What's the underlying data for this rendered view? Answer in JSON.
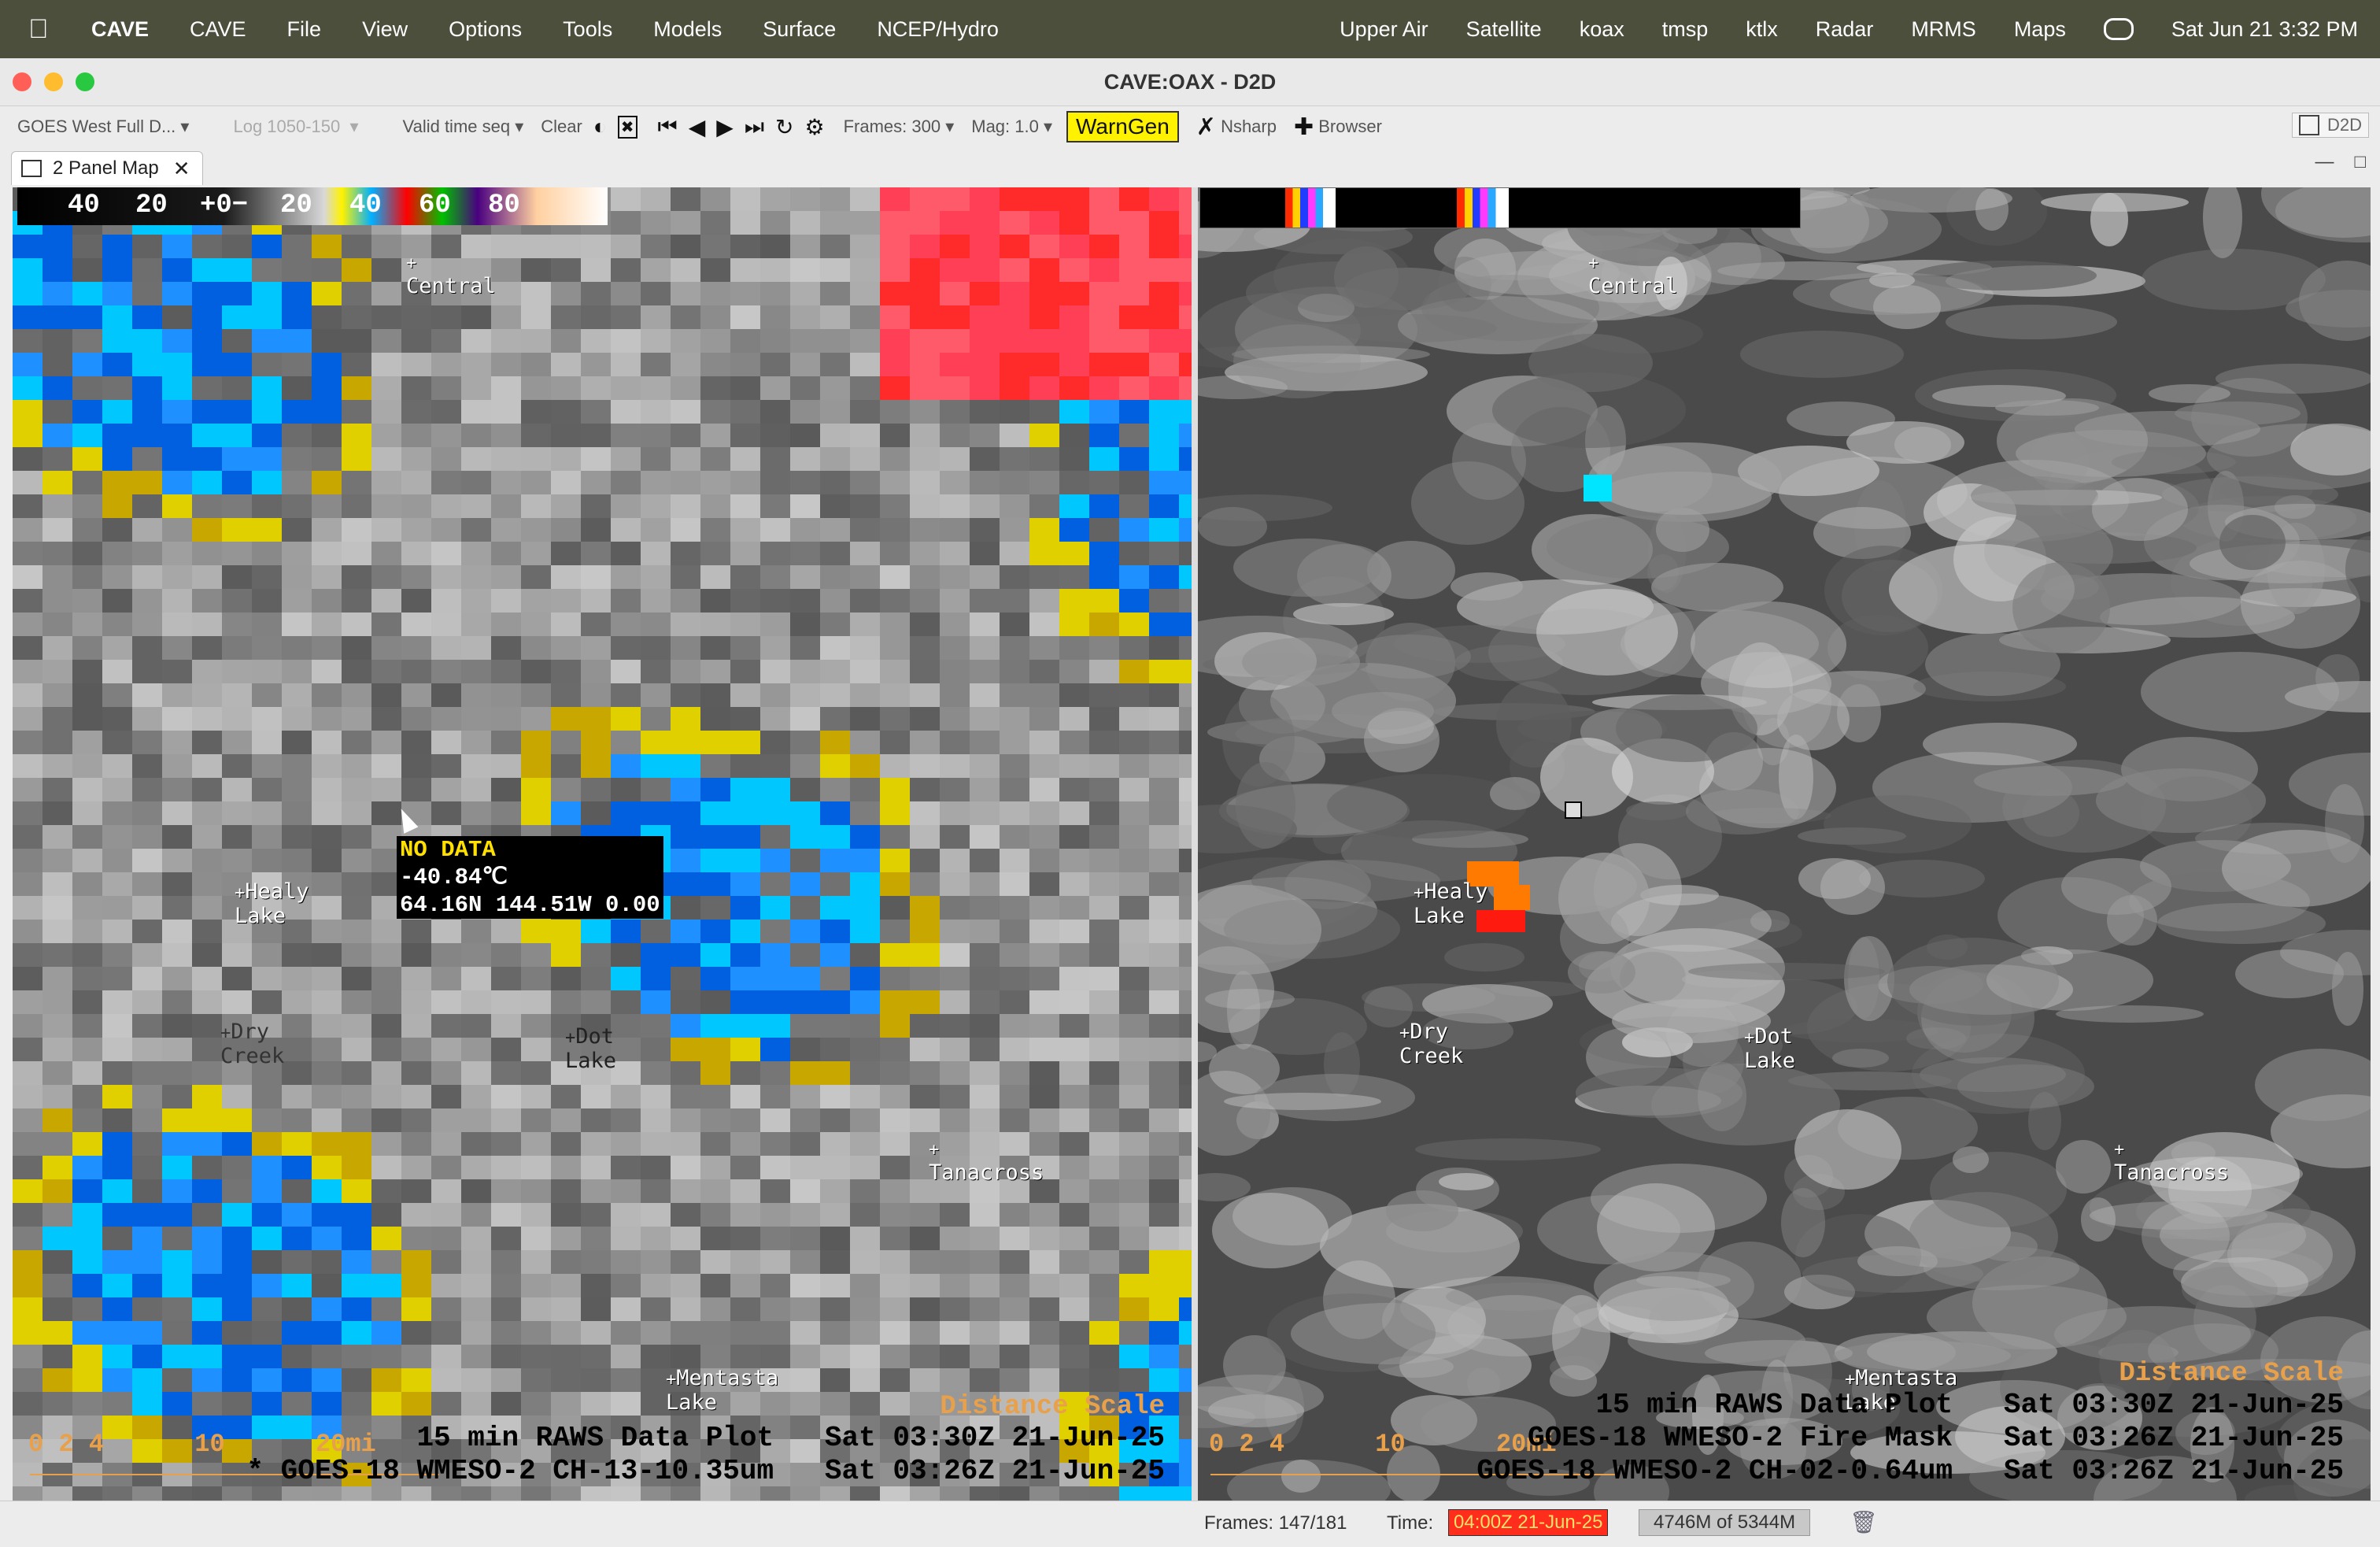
{
  "menubar": {
    "app": "CAVE",
    "items": [
      "CAVE",
      "File",
      "View",
      "Options",
      "Tools",
      "Models",
      "Surface",
      "NCEP/Hydro"
    ],
    "right_items": [
      "Upper Air",
      "Satellite",
      "koax",
      "tmsp",
      "ktlx",
      "Radar",
      "MRMS",
      "Maps"
    ],
    "clock": "Sat Jun 21  3:32 PM"
  },
  "window": {
    "title": "CAVE:OAX - D2D"
  },
  "toolbar": {
    "product": "GOES West Full D...",
    "scale": "Log 1050-150",
    "time_seq": "Valid time seq",
    "clear": "Clear",
    "frames": "Frames: 300",
    "mag": "Mag: 1.0",
    "warngen": "WarnGen",
    "nsharp": "Nsharp",
    "browser": "Browser",
    "perspective": "D2D"
  },
  "tab": {
    "label": "2 Panel Map"
  },
  "left_panel": {
    "colorbar_labels": [
      "40",
      "20",
      "+0−",
      "20",
      "40",
      "60",
      "80"
    ],
    "cursor_readout": [
      "NO DATA",
      "-40.84℃",
      "64.16N 144.51W 0.00"
    ],
    "places": [
      {
        "id": "central",
        "name": "Central"
      },
      {
        "id": "healy",
        "name": "Healy\nLake"
      },
      {
        "id": "dry",
        "name": "Dry\nCreek"
      },
      {
        "id": "dot",
        "name": "Dot\nLake"
      },
      {
        "id": "tanacross",
        "name": "Tanacross"
      },
      {
        "id": "mentasta",
        "name": "Mentasta\nLake"
      }
    ],
    "distance_scale": "Distance Scale",
    "scale_ticks": "0 2 4      10      20mi",
    "legend": [
      {
        "text": "15 min RAWS Data Plot   Sat 03:30Z 21-Jun-25",
        "color": "#f2e016"
      },
      {
        "text": "* GOES-18 WMESO-2 CH-13-10.35um   Sat 03:26Z 21-Jun-25",
        "color": "#ffffff"
      }
    ]
  },
  "right_panel": {
    "places": [
      {
        "id": "central",
        "name": "Central"
      },
      {
        "id": "healy",
        "name": "Healy\nLake"
      },
      {
        "id": "dry",
        "name": "Dry\nCreek"
      },
      {
        "id": "dot",
        "name": "Dot\nLake"
      },
      {
        "id": "tanacross",
        "name": "Tanacross"
      },
      {
        "id": "mentasta",
        "name": "Mentasta\nLake"
      }
    ],
    "distance_scale": "Distance Scale",
    "scale_ticks": "0 2 4      10      20mi",
    "legend": [
      {
        "text": "15 min RAWS Data Plot   Sat 03:30Z 21-Jun-25",
        "color": "#f2e016"
      },
      {
        "text": "GOES-18 WMESO-2 Fire Mask   Sat 03:26Z 21-Jun-25",
        "color": "#ff2a1a"
      },
      {
        "text": "GOES-18 WMESO-2 CH-02-0.64um   Sat 03:26Z 21-Jun-25",
        "color": "#ffffff"
      }
    ]
  },
  "statusbar": {
    "frames": "Frames:  147/181",
    "time_label": "Time:",
    "time_value": "04:00Z 21-Jun-25",
    "memory": "4746M of 5344M"
  }
}
